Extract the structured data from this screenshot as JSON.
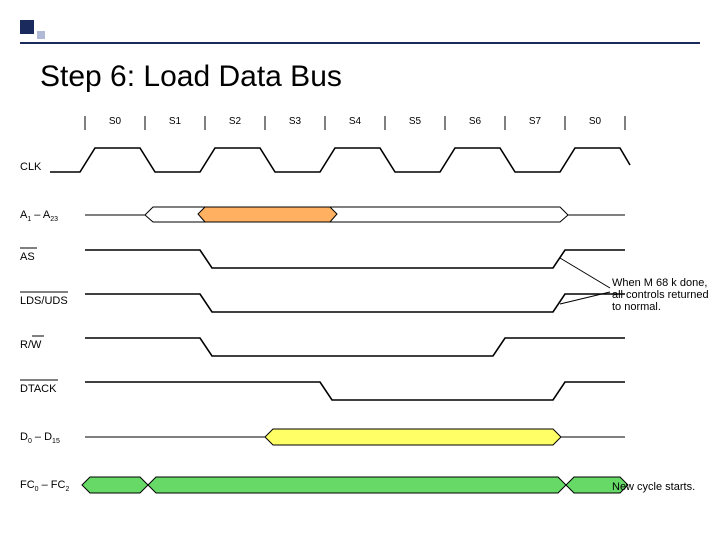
{
  "title": "Step 6: Load Data Bus",
  "states": [
    "S0",
    "S1",
    "S2",
    "S3",
    "S4",
    "S5",
    "S6",
    "S7",
    "S0"
  ],
  "signals": {
    "clk": "CLK",
    "addr_prefix_a": "A",
    "addr_1": "1",
    "addr_dash": " – A",
    "addr_23": "23",
    "as": "AS",
    "ldsuds": "LDS/UDS",
    "rw": "R/W",
    "dtack": "DTACK",
    "d_prefix": "D",
    "d_0": "0",
    "d_dash": " – D",
    "d_15": "15",
    "fc_prefix": "FC",
    "fc_0": "0",
    "fc_dash": " – FC",
    "fc_2": "2"
  },
  "annotations": {
    "when_done_1": "When M 68 k done,",
    "when_done_2": "all controls returned",
    "when_done_3": "to normal.",
    "new_cycle": "New cycle starts."
  },
  "colors": {
    "addr_fill": "#ffb060",
    "data_fill": "#ffff66",
    "fc_fill": "#66d966"
  },
  "chart_data": {
    "type": "timing-diagram",
    "clock_states": [
      "S0",
      "S1",
      "S2",
      "S3",
      "S4",
      "S5",
      "S6",
      "S7",
      "S0"
    ],
    "rows": [
      {
        "name": "CLK",
        "kind": "clock",
        "period_states": 2
      },
      {
        "name": "A1-A23",
        "kind": "bus",
        "valid_from": "S1",
        "valid_to": "S7_end",
        "highlighted_window": [
          "S1",
          "S4"
        ]
      },
      {
        "name": "AS",
        "kind": "active_low",
        "asserted": [
          "S2",
          "S7"
        ]
      },
      {
        "name": "LDS/UDS",
        "kind": "active_low",
        "asserted": [
          "S2",
          "S7"
        ]
      },
      {
        "name": "R/W",
        "kind": "active_low",
        "asserted": [
          "S2",
          "S6"
        ]
      },
      {
        "name": "DTACK",
        "kind": "active_low",
        "asserted": [
          "S4",
          "S7"
        ]
      },
      {
        "name": "D0-D15",
        "kind": "bus",
        "valid_from": "S3",
        "valid_to": "S7",
        "highlighted_window": [
          "S3",
          "S7"
        ]
      },
      {
        "name": "FC0-FC2",
        "kind": "bus",
        "valid_from": "S0",
        "valid_to": "S7_end",
        "gaps_at": [
          "S1",
          "S7_end"
        ]
      }
    ],
    "callouts": [
      {
        "text": "When M68k done, all controls returned to normal.",
        "anchor_state": "S7_end",
        "rows": [
          "AS",
          "LDS/UDS"
        ]
      },
      {
        "text": "New cycle starts.",
        "anchor_state": "S7_end",
        "rows": [
          "FC0-FC2"
        ]
      }
    ]
  }
}
